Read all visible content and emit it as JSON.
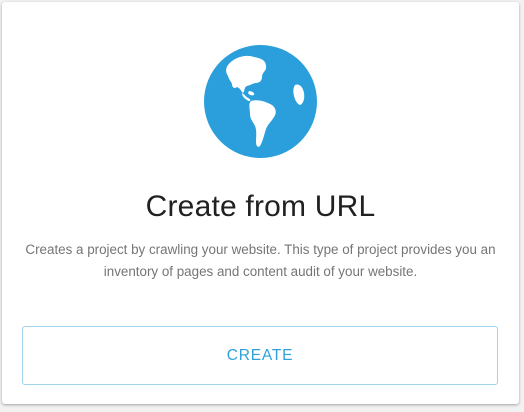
{
  "card": {
    "icon": "globe-americas-icon",
    "title": "Create from URL",
    "description": "Creates a project by crawling your website. This type of project provides you an inventory of pages and content audit of your website.",
    "button_label": "CREATE"
  },
  "colors": {
    "accent": "#2fa0dc",
    "globe": "#2b9fdc",
    "button_border": "#9ed3ea",
    "title_text": "#212121",
    "description_text": "#757575"
  }
}
